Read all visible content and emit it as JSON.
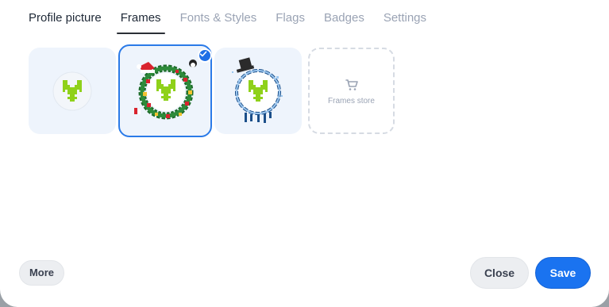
{
  "tabs": [
    {
      "label": "Profile picture"
    },
    {
      "label": "Frames"
    },
    {
      "label": "Fonts & Styles"
    },
    {
      "label": "Flags"
    },
    {
      "label": "Badges"
    },
    {
      "label": "Settings"
    }
  ],
  "active_tab": "Frames",
  "frames": [
    {
      "name": "No frame",
      "selected": false
    },
    {
      "name": "Christmas wreath",
      "selected": true
    },
    {
      "name": "Frosty winter",
      "selected": false
    }
  ],
  "store": {
    "label": "Frames store",
    "icon": "cart-icon"
  },
  "buttons": {
    "more": "More",
    "close": "Close",
    "save": "Save"
  },
  "colors": {
    "accent": "#1a73f0",
    "avatar_green": "#8fd11a"
  }
}
